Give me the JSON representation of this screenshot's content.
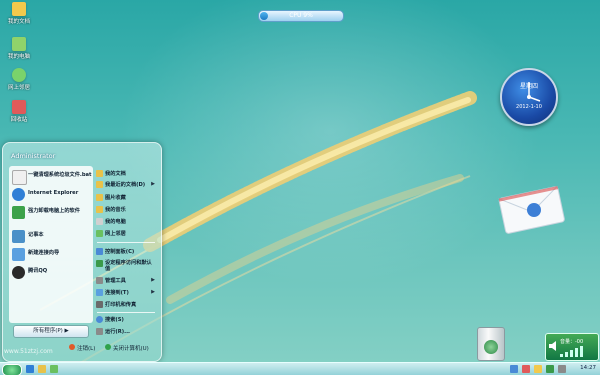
{
  "desktop_icons": [
    {
      "name": "docs",
      "label": "我的文档",
      "color": "#f2c94c"
    },
    {
      "name": "computer",
      "label": "我的电脑",
      "color": "#e8e8e8"
    },
    {
      "name": "network",
      "label": "网上邻居",
      "color": "#7ad36b"
    },
    {
      "name": "recycle",
      "label": "回收站",
      "color": "#d6d6d6"
    }
  ],
  "cpu_meter": {
    "label": "CPU 9%",
    "value_percent": 9
  },
  "clock": {
    "day": "星期四",
    "date": "2012-1-10"
  },
  "start_menu": {
    "user": "Administrator",
    "left_items": [
      {
        "icon": "doc-icon",
        "label": "一键清理系统垃圾文件.bat",
        "color": "#f0f0f0"
      },
      {
        "icon": "ie-icon",
        "label": "Internet Explorer",
        "color": "#2f7fd6"
      },
      {
        "icon": "uninstall-icon",
        "label": "强力卸载电脑上的软件",
        "color": "#3ca24a"
      },
      {
        "icon": "notepad-icon",
        "label": "记事本",
        "color": "#4a90c8"
      },
      {
        "icon": "connection-icon",
        "label": "新建连接向导",
        "color": "#5aa0e0"
      },
      {
        "icon": "qq-icon",
        "label": "腾讯QQ",
        "color": "#2a2a2a"
      }
    ],
    "right_items": [
      {
        "icon": "docs-icon",
        "label": "我的文档",
        "color": "#e8c24a",
        "arrow": ""
      },
      {
        "icon": "recent-icon",
        "label": "我最近的文档(D)",
        "color": "#e8c24a",
        "arrow": "▶"
      },
      {
        "icon": "pictures-icon",
        "label": "图片收藏",
        "color": "#e8c24a",
        "arrow": ""
      },
      {
        "icon": "music-icon",
        "label": "我的音乐",
        "color": "#e8c24a",
        "arrow": ""
      },
      {
        "icon": "computer-icon",
        "label": "我的电脑",
        "color": "#d0d0d0",
        "arrow": ""
      },
      {
        "icon": "network-icon",
        "label": "网上邻居",
        "color": "#6ac060",
        "arrow": ""
      },
      {
        "icon": "control-icon",
        "label": "控制面板(C)",
        "color": "#4a8ad6",
        "arrow": ""
      },
      {
        "icon": "defaults-icon",
        "label": "设定程序访问和默认值",
        "color": "#3a9a4a",
        "arrow": ""
      },
      {
        "icon": "admin-icon",
        "label": "管理工具",
        "color": "#8a8a8a",
        "arrow": "▶"
      },
      {
        "icon": "connect-icon",
        "label": "连接到(T)",
        "color": "#5aa0e0",
        "arrow": "▶"
      },
      {
        "icon": "printer-icon",
        "label": "打印机和传真",
        "color": "#6a6a6a",
        "arrow": ""
      },
      {
        "icon": "search-icon",
        "label": "搜索(S)",
        "color": "#4a8ad6",
        "arrow": ""
      },
      {
        "icon": "run-icon",
        "label": "运行(R)...",
        "color": "#8a8a8a",
        "arrow": ""
      }
    ],
    "all_programs": "所有程序(P) ▶",
    "logoff": "注销(L)",
    "shutdown": "关闭计算机(U)"
  },
  "watermark": "www.51ztzj.com",
  "volume_widget": {
    "label": "音量：-00"
  },
  "taskbar": {
    "time": "14:27"
  }
}
